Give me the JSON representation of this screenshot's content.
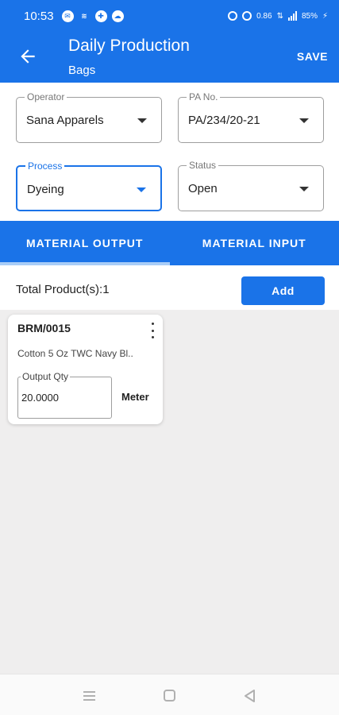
{
  "status_bar": {
    "time": "10:53",
    "left_icons": [
      "message-icon",
      "signal-icon",
      "plus-icon",
      "cloud-icon"
    ],
    "right_icons": [
      "location-icon",
      "alarm-icon",
      "data-rate-icon",
      "network-icon",
      "signal-icon",
      "battery-icon"
    ],
    "speed": "0.86",
    "battery": "85%"
  },
  "app_bar": {
    "title": "Daily Production",
    "subtitle": "Bags",
    "save_label": "SAVE",
    "back_icon": "arrow-left-icon"
  },
  "form": {
    "operator": {
      "label": "Operator",
      "value": "Sana Apparels"
    },
    "pa_no": {
      "label": "PA No.",
      "value": "PA/234/20-21"
    },
    "process": {
      "label": "Process",
      "value": "Dyeing"
    },
    "status": {
      "label": "Status",
      "value": "Open"
    }
  },
  "tabs": [
    {
      "label": "MATERIAL OUTPUT",
      "active": true
    },
    {
      "label": "MATERIAL INPUT",
      "active": false
    }
  ],
  "summary": {
    "total_label": "Total Product(s):1",
    "add_label": "Add"
  },
  "products": [
    {
      "code": "BRM/0015",
      "description": "Cotton 5 Oz TWC Navy Bl..",
      "qty_label": "Output Qty",
      "qty_value": "20.0000",
      "unit": "Meter"
    }
  ],
  "nav_bar": {
    "icons": [
      "menu-icon",
      "home-icon",
      "back-icon"
    ]
  },
  "colors": {
    "primary": "#1a73e8",
    "tab_indicator": "#a9cdf7",
    "background": "#efeeee"
  }
}
